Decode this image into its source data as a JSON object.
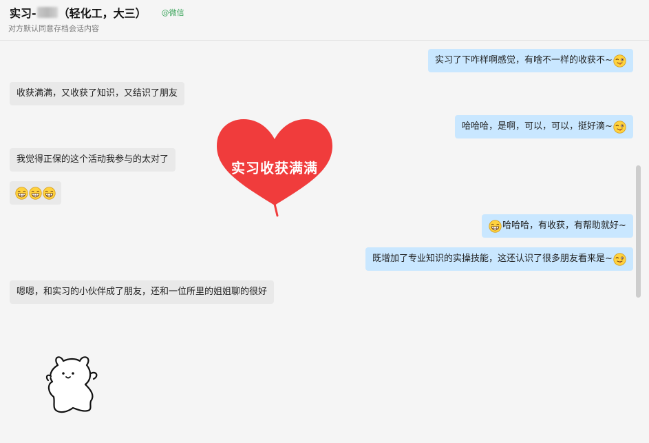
{
  "header": {
    "title_prefix": "实习-",
    "title_suffix": "（轻化工，大三）",
    "source_tag": "@微信",
    "subtitle": "对方默认同意存档会话内容"
  },
  "sticker": {
    "text": "实习收获满满",
    "color": "#f03c3c"
  },
  "colors": {
    "sent_bubble": "#c9e7ff",
    "received_bubble": "#e9e9e9",
    "background": "#f5f5f5",
    "wechat_tag": "#3ca55c"
  },
  "messages": [
    {
      "side": "sent",
      "text": "实习了下咋样啊感觉，有啥不一样的收获不~",
      "emoji_after": "wink-tongue"
    },
    {
      "side": "received",
      "text": "收获满满，又收获了知识，又结识了朋友"
    },
    {
      "side": "sent",
      "text": "哈哈哈，是啊，可以，可以，挺好滴~",
      "emoji_after": "wink-tongue"
    },
    {
      "side": "received",
      "text": "我觉得正保的这个活动我参与的太对了"
    },
    {
      "side": "received",
      "text": "",
      "emoji_only": [
        "grin",
        "grin",
        "grin"
      ]
    },
    {
      "side": "sent",
      "text": "哈哈哈，有收获，有帮助就好~",
      "emoji_before": "grin"
    },
    {
      "side": "sent",
      "text": "既增加了专业知识的实操技能，这还认识了很多朋友看来是~",
      "emoji_after": "wink-tongue"
    },
    {
      "side": "received",
      "text": "嗯嗯，和实习的小伙伴成了朋友，还和一位所里的姐姐聊的很好"
    }
  ]
}
